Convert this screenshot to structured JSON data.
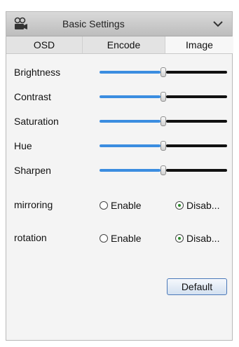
{
  "header": {
    "title": "Basic Settings",
    "icon": "camera-icon",
    "toggle_icon": "chevron-down-icon"
  },
  "tabs": [
    {
      "label": "OSD",
      "active": false
    },
    {
      "label": "Encode",
      "active": false
    },
    {
      "label": "Image",
      "active": true
    }
  ],
  "sliders": [
    {
      "label": "Brightness",
      "value_fraction": 0.5
    },
    {
      "label": "Contrast",
      "value_fraction": 0.5
    },
    {
      "label": "Saturation",
      "value_fraction": 0.5
    },
    {
      "label": "Hue",
      "value_fraction": 0.5
    },
    {
      "label": "Sharpen",
      "value_fraction": 0.5
    }
  ],
  "options": [
    {
      "label": "mirroring",
      "enable_label": "Enable",
      "disable_label": "Disab...",
      "selected": "disable"
    },
    {
      "label": "rotation",
      "enable_label": "Enable",
      "disable_label": "Disab...",
      "selected": "disable"
    }
  ],
  "buttons": {
    "default_label": "Default"
  },
  "colors": {
    "slider_fill": "#3b8de0",
    "slider_rest": "#111111",
    "radio_dot": "#2a8a2a",
    "button_border": "#4a78b8"
  }
}
